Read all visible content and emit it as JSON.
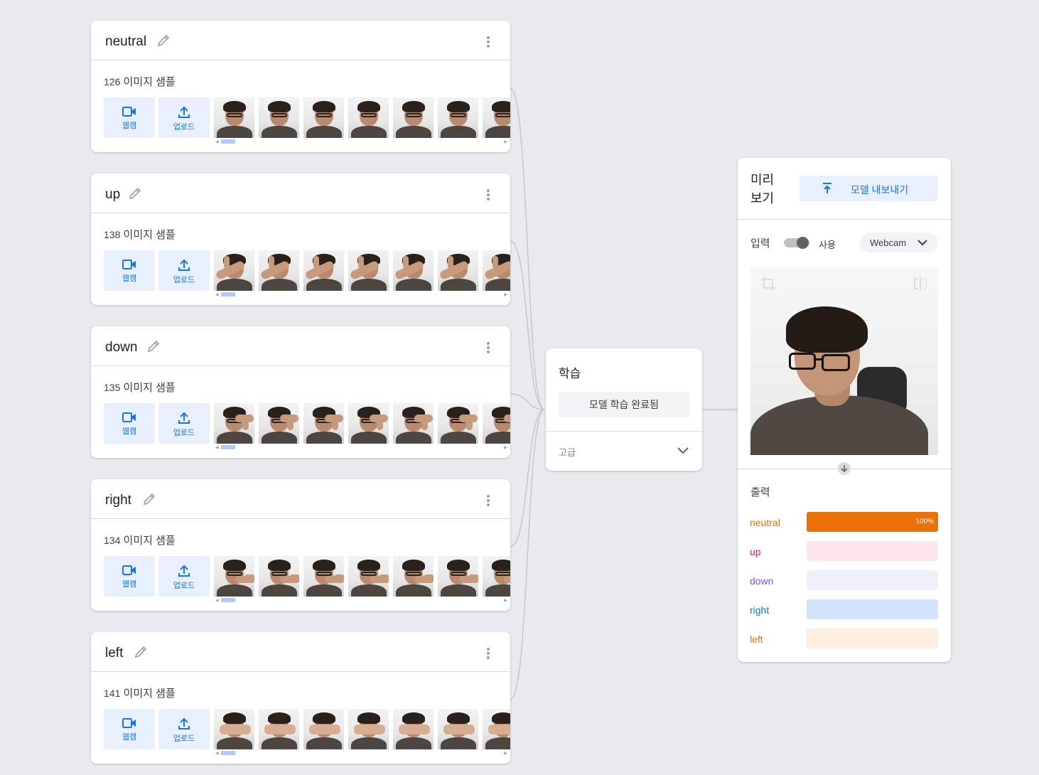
{
  "classes": [
    {
      "name": "neutral",
      "count": "126",
      "samples_label": "이미지 샘플",
      "pose": "neutral"
    },
    {
      "name": "up",
      "count": "138",
      "samples_label": "이미지 샘플",
      "pose": "up"
    },
    {
      "name": "down",
      "count": "135",
      "samples_label": "이미지 샘플",
      "pose": "down"
    },
    {
      "name": "right",
      "count": "134",
      "samples_label": "이미지 샘플",
      "pose": "right"
    },
    {
      "name": "left",
      "count": "141",
      "samples_label": "이미지 샘플",
      "pose": "left"
    }
  ],
  "class_tools": {
    "webcam_label": "웹캠",
    "upload_label": "업로드"
  },
  "icons": {
    "edit": "pencil-icon",
    "more": "kebab-menu-icon",
    "webcam": "video-camera-icon",
    "upload": "upload-icon",
    "export": "export-icon",
    "crop": "crop-icon",
    "flip": "flip-icon",
    "dropdown": "chevron-down-icon",
    "arrow": "arrow-down-icon"
  },
  "training": {
    "title": "학습",
    "button_label": "모델 학습 완료됨",
    "advanced_label": "고급"
  },
  "preview": {
    "title": "미리 보기",
    "export_label": "모델 내보내기",
    "input_label": "입력",
    "toggle_label": "사용",
    "toggle_on": true,
    "source_selected": "Webcam",
    "output_label": "출력",
    "outputs": [
      {
        "name": "neutral",
        "value": 1.0,
        "value_label": "100%",
        "color": "#e8710a",
        "track": "#fce8d6"
      },
      {
        "name": "up",
        "value": 0.0,
        "value_label": "",
        "color": "#d01884",
        "track": "#fde7ea"
      },
      {
        "name": "down",
        "value": 0.0,
        "value_label": "",
        "color": "#7c4dff",
        "track": "#f0effc"
      },
      {
        "name": "right",
        "value": 0.0,
        "value_label": "",
        "color": "#1a73e8",
        "track": "#d2e3fc"
      },
      {
        "name": "left",
        "value": 0.0,
        "value_label": "",
        "color": "#e8710a",
        "track": "#feede1"
      }
    ]
  },
  "colors": {
    "accent": "#1a73e8",
    "accent_light": "#e8f0fe",
    "background": "#e8eaed"
  }
}
